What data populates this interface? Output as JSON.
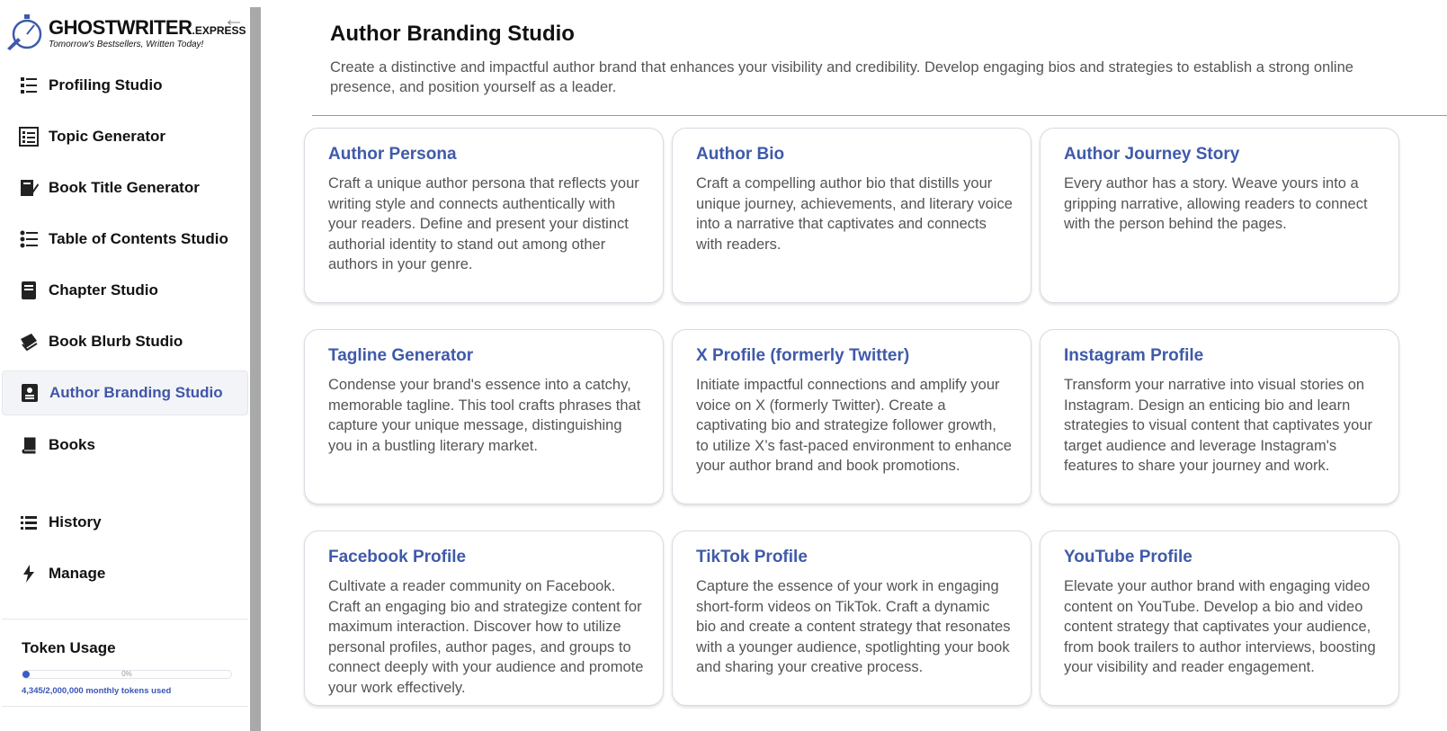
{
  "brand": {
    "logo_word": "GHOSTWRITER",
    "logo_suffix": ".EXPRESS",
    "tagline": "Tomorrow's Bestsellers, Written Today!"
  },
  "sidebar": {
    "items": [
      {
        "label": "Profiling Studio",
        "icon": "profiling-icon"
      },
      {
        "label": "Topic Generator",
        "icon": "topic-icon"
      },
      {
        "label": "Book Title Generator",
        "icon": "book-title-icon"
      },
      {
        "label": "Table of Contents Studio",
        "icon": "toc-icon"
      },
      {
        "label": "Chapter Studio",
        "icon": "chapter-icon"
      },
      {
        "label": "Book Blurb Studio",
        "icon": "blurb-icon"
      },
      {
        "label": "Author Branding Studio",
        "icon": "author-branding-icon",
        "active": true
      },
      {
        "label": "Books",
        "icon": "books-icon"
      },
      {
        "label": "History",
        "icon": "history-icon"
      },
      {
        "label": "Manage",
        "icon": "manage-icon"
      }
    ],
    "token_usage": {
      "title": "Token Usage",
      "percent_label": "0%",
      "used_text": "4,345/2,000,000 monthly tokens used",
      "fraction": 0.0022
    }
  },
  "main": {
    "title": "Author Branding Studio",
    "description": "Create a distinctive and impactful author brand that enhances your visibility and credibility. Develop engaging bios and strategies to establish a strong online presence, and position yourself as a leader.",
    "cards": [
      {
        "title": "Author Persona",
        "desc": "Craft a unique author persona that reflects your writing style and connects authentically with your readers. Define and present your distinct authorial identity to stand out among other authors in your genre."
      },
      {
        "title": "Author Bio",
        "desc": "Craft a compelling author bio that distills your unique journey, achievements, and literary voice into a narrative that captivates and connects with readers."
      },
      {
        "title": "Author Journey Story",
        "desc": "Every author has a story. Weave yours into a gripping narrative, allowing readers to connect with the person behind the pages."
      },
      {
        "title": "Tagline Generator",
        "desc": "Condense your brand's essence into a catchy, memorable tagline. This tool crafts phrases that capture your unique message, distinguishing you in a bustling literary market."
      },
      {
        "title": "X Profile (formerly Twitter)",
        "desc": "Initiate impactful connections and amplify your voice on X (formerly Twitter). Create a captivating bio and strategize follower growth, to utilize X’s fast-paced environment to enhance your author brand and book promotions."
      },
      {
        "title": "Instagram Profile",
        "desc": "Transform your narrative into visual stories on Instagram. Design an enticing bio and learn strategies to visual content that captivates your target audience and leverage Instagram's features to share your journey and work."
      },
      {
        "title": "Facebook Profile",
        "desc": "Cultivate a reader community on Facebook. Craft an engaging bio and strategize content for maximum interaction. Discover how to utilize personal profiles, author pages, and groups to connect deeply with your audience and promote your work effectively."
      },
      {
        "title": "TikTok Profile",
        "desc": "Capture the essence of your work in engaging short-form videos on TikTok. Craft a dynamic bio and create a content strategy that resonates with a younger audience, spotlighting your book and sharing your creative process."
      },
      {
        "title": "YouTube Profile",
        "desc": "Elevate your author brand with engaging video content on YouTube. Develop a bio and video content strategy that captivates your audience, from book trailers to author interviews, boosting your visibility and reader engagement."
      }
    ]
  },
  "colors": {
    "accent": "#3f5aa9",
    "active_bg": "#f3f4f8",
    "scrollbar": "#a9a9a9"
  }
}
